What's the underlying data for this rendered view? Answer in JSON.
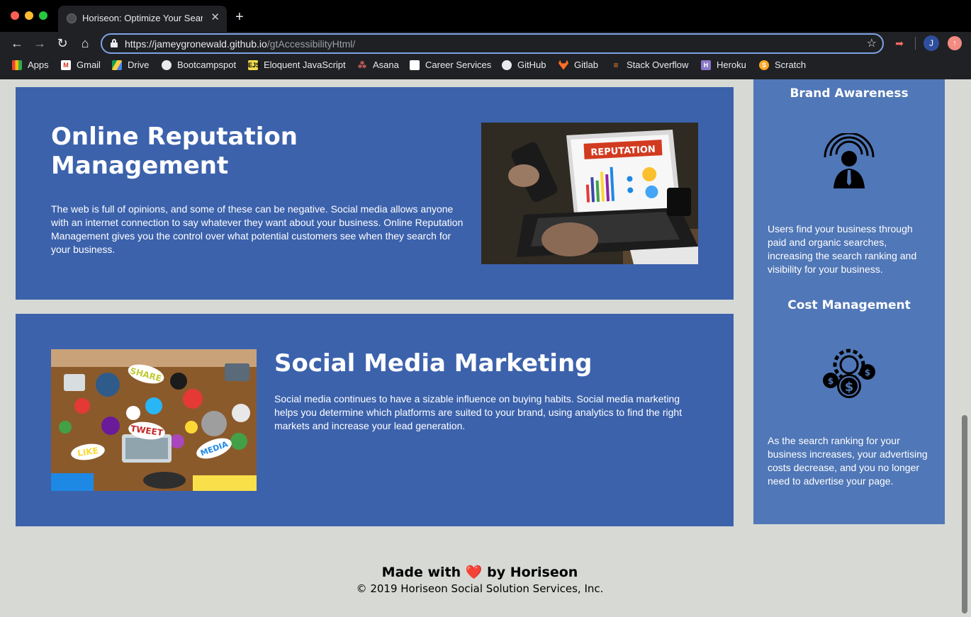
{
  "browser": {
    "tab_title": "Horiseon: Optimize Your Searc",
    "tab_close": "✕",
    "new_tab": "+",
    "url_host": "https://jameygronewald.github.io",
    "url_path": "/gtAccessibilityHtml/",
    "profile_initial": "J",
    "bookmarks": [
      {
        "label": "Apps",
        "icon": "apps-grid-icon"
      },
      {
        "label": "Gmail",
        "icon": "gmail-icon"
      },
      {
        "label": "Drive",
        "icon": "drive-icon"
      },
      {
        "label": "Bootcampspot",
        "icon": "globe-icon"
      },
      {
        "label": "Eloquent JavaScript",
        "icon": "ejs-icon"
      },
      {
        "label": "Asana",
        "icon": "asana-icon"
      },
      {
        "label": "Career Services",
        "icon": "career-services-icon"
      },
      {
        "label": "GitHub",
        "icon": "github-icon"
      },
      {
        "label": "Gitlab",
        "icon": "gitlab-icon"
      },
      {
        "label": "Stack Overflow",
        "icon": "stackoverflow-icon"
      },
      {
        "label": "Heroku",
        "icon": "heroku-icon"
      },
      {
        "label": "Scratch",
        "icon": "scratch-icon"
      }
    ]
  },
  "sections": [
    {
      "title": "Online Reputation Management",
      "body": "The web is full of opinions, and some of these can be negative. Social media allows anyone with an internet connection to say whatever they want about your business. Online Reputation Management gives you the control over what potential customers see when they search for your business.",
      "image_text": "REPUTATION"
    },
    {
      "title": "Social Media Marketing",
      "body": "Social media continues to have a sizable influence on buying habits. Social media marketing helps you determine which platforms are suited to your brand, using analytics to find the right markets and increase your lead generation.",
      "image_words": [
        "SHARE",
        "TWEET",
        "LIKE",
        "MEDIA"
      ]
    }
  ],
  "benefits": [
    {
      "title": "Brand Awareness",
      "body": "Users find your business through paid and organic searches, increasing the search ranking and visibility for your business."
    },
    {
      "title": "Cost Management",
      "body": "As the search ranking for your business increases, your advertising costs decrease, and you no longer need to advertise your page."
    }
  ],
  "footer": {
    "made_with": "Made with",
    "heart": "❤️",
    "by": "by Horiseon",
    "copyright": "© 2019 Horiseon Social Solution Services, Inc."
  },
  "colors": {
    "card_blue": "#3c62ac",
    "sidebar_blue": "#5077b7",
    "page_bg": "#d6d9d4"
  }
}
